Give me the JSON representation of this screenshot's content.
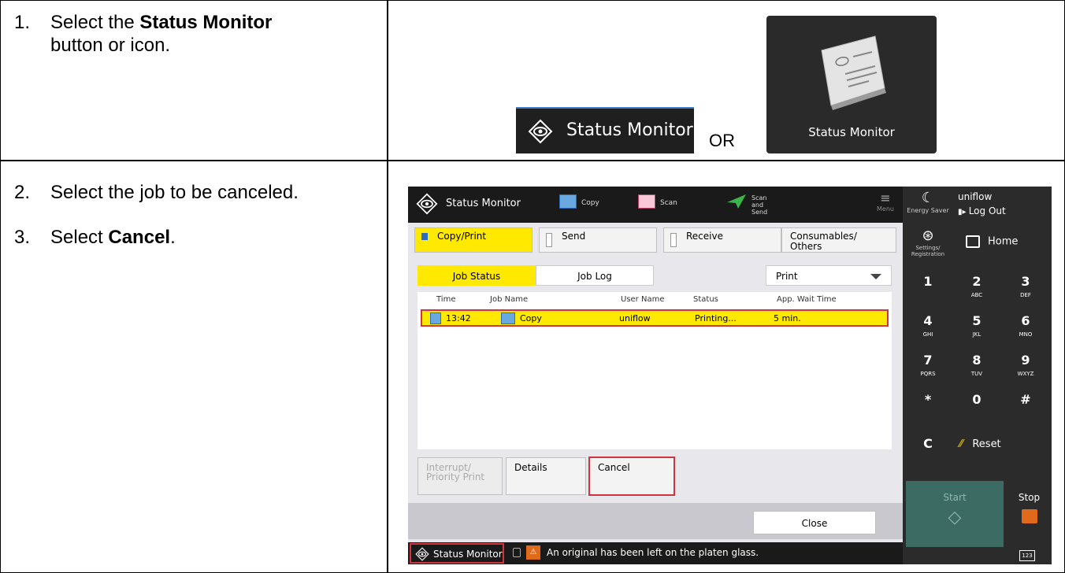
{
  "steps": [
    {
      "num": "1.",
      "pre": "Select the ",
      "bold": "Status Monitor",
      "post": "",
      "line2": "button or icon."
    },
    {
      "num": "2.",
      "text": "Select the job to be canceled."
    },
    {
      "num": "3.",
      "pre": "Select ",
      "bold": "Cancel",
      "post": "."
    }
  ],
  "top": {
    "button_label": "Status Monitor",
    "or": "OR",
    "tile_label": "Status Monitor"
  },
  "device": {
    "title": "Status Monitor",
    "tabs": [
      "Copy",
      "Scan",
      "Scan and Send"
    ],
    "menu": "Menu",
    "energy_saver": "Energy Saver",
    "user": "uniflow",
    "logout": "Log Out",
    "settings": "Settings/ Registration",
    "home": "Home",
    "categories": [
      "Copy/Print",
      "Send",
      "Receive",
      "Consumables/ Others"
    ],
    "job_tabs": [
      "Job Status",
      "Job Log"
    ],
    "print_select": "Print",
    "columns": [
      "Time",
      "Job Name",
      "User Name",
      "Status",
      "App. Wait Time"
    ],
    "job": {
      "time": "13:42",
      "name": "Copy",
      "user": "uniflow",
      "status": "Printing...",
      "wait": "5 min."
    },
    "keys": [
      {
        "k": "1",
        "s": ""
      },
      {
        "k": "2",
        "s": "ABC"
      },
      {
        "k": "3",
        "s": "DEF"
      },
      {
        "k": "4",
        "s": "GHI"
      },
      {
        "k": "5",
        "s": "JKL"
      },
      {
        "k": "6",
        "s": "MNO"
      },
      {
        "k": "7",
        "s": "PQRS"
      },
      {
        "k": "8",
        "s": "TUV"
      },
      {
        "k": "9",
        "s": "WXYZ"
      },
      {
        "k": "*",
        "s": ""
      },
      {
        "k": "0",
        "s": ""
      },
      {
        "k": "#",
        "s": ""
      }
    ],
    "clear_key": "C",
    "reset": "Reset",
    "start": "Start",
    "stop": "Stop",
    "interrupt": "Interrupt/ Priority Print",
    "details": "Details",
    "cancel": "Cancel",
    "close": "Close",
    "status_monitor_btn": "Status Monitor",
    "message": "An original has been left on the platen glass.",
    "kbd": "123"
  }
}
